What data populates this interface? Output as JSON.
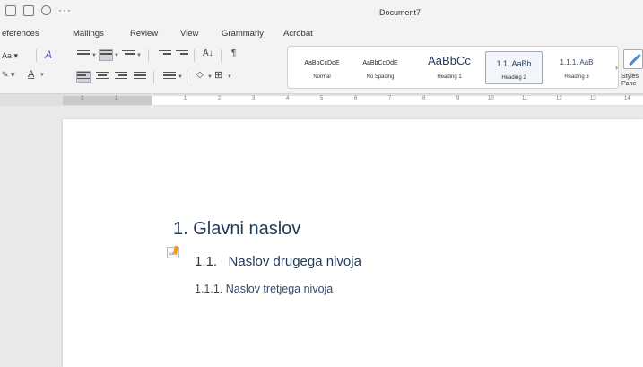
{
  "window": {
    "title": "Document7"
  },
  "tabs": [
    "eferences",
    "Mailings",
    "Review",
    "View",
    "Grammarly",
    "Acrobat"
  ],
  "ribbon": {
    "font_size_label": "Aa",
    "font_color_label": "A",
    "styles": [
      {
        "sample": "AaBbCcDdE",
        "name": "Normal"
      },
      {
        "sample": "AaBbCcDdE",
        "name": "No Spacing"
      },
      {
        "sample": "AaBbCc",
        "name": "Heading 1"
      },
      {
        "sample": "1.1. AaBb",
        "name": "Heading 2",
        "selected": true
      },
      {
        "sample": "1.1.1. AaB",
        "name": "Heading 3"
      }
    ],
    "styles_pane_label": "Styles Pane"
  },
  "ruler": {
    "numbers": [
      "2",
      "1",
      "1",
      "2",
      "3",
      "4",
      "5",
      "6",
      "7",
      "8",
      "9",
      "10",
      "11",
      "12",
      "13",
      "14"
    ]
  },
  "document": {
    "heading1": "1. Glavni naslov",
    "heading2": "1.1.   Naslov drugega nivoja",
    "heading3": "1.1.1. Naslov tretjega nivoja"
  },
  "colors": {
    "heading": "#1f3a5a",
    "ribbon_bg": "#f3f3f3",
    "selection": "#9ab"
  }
}
